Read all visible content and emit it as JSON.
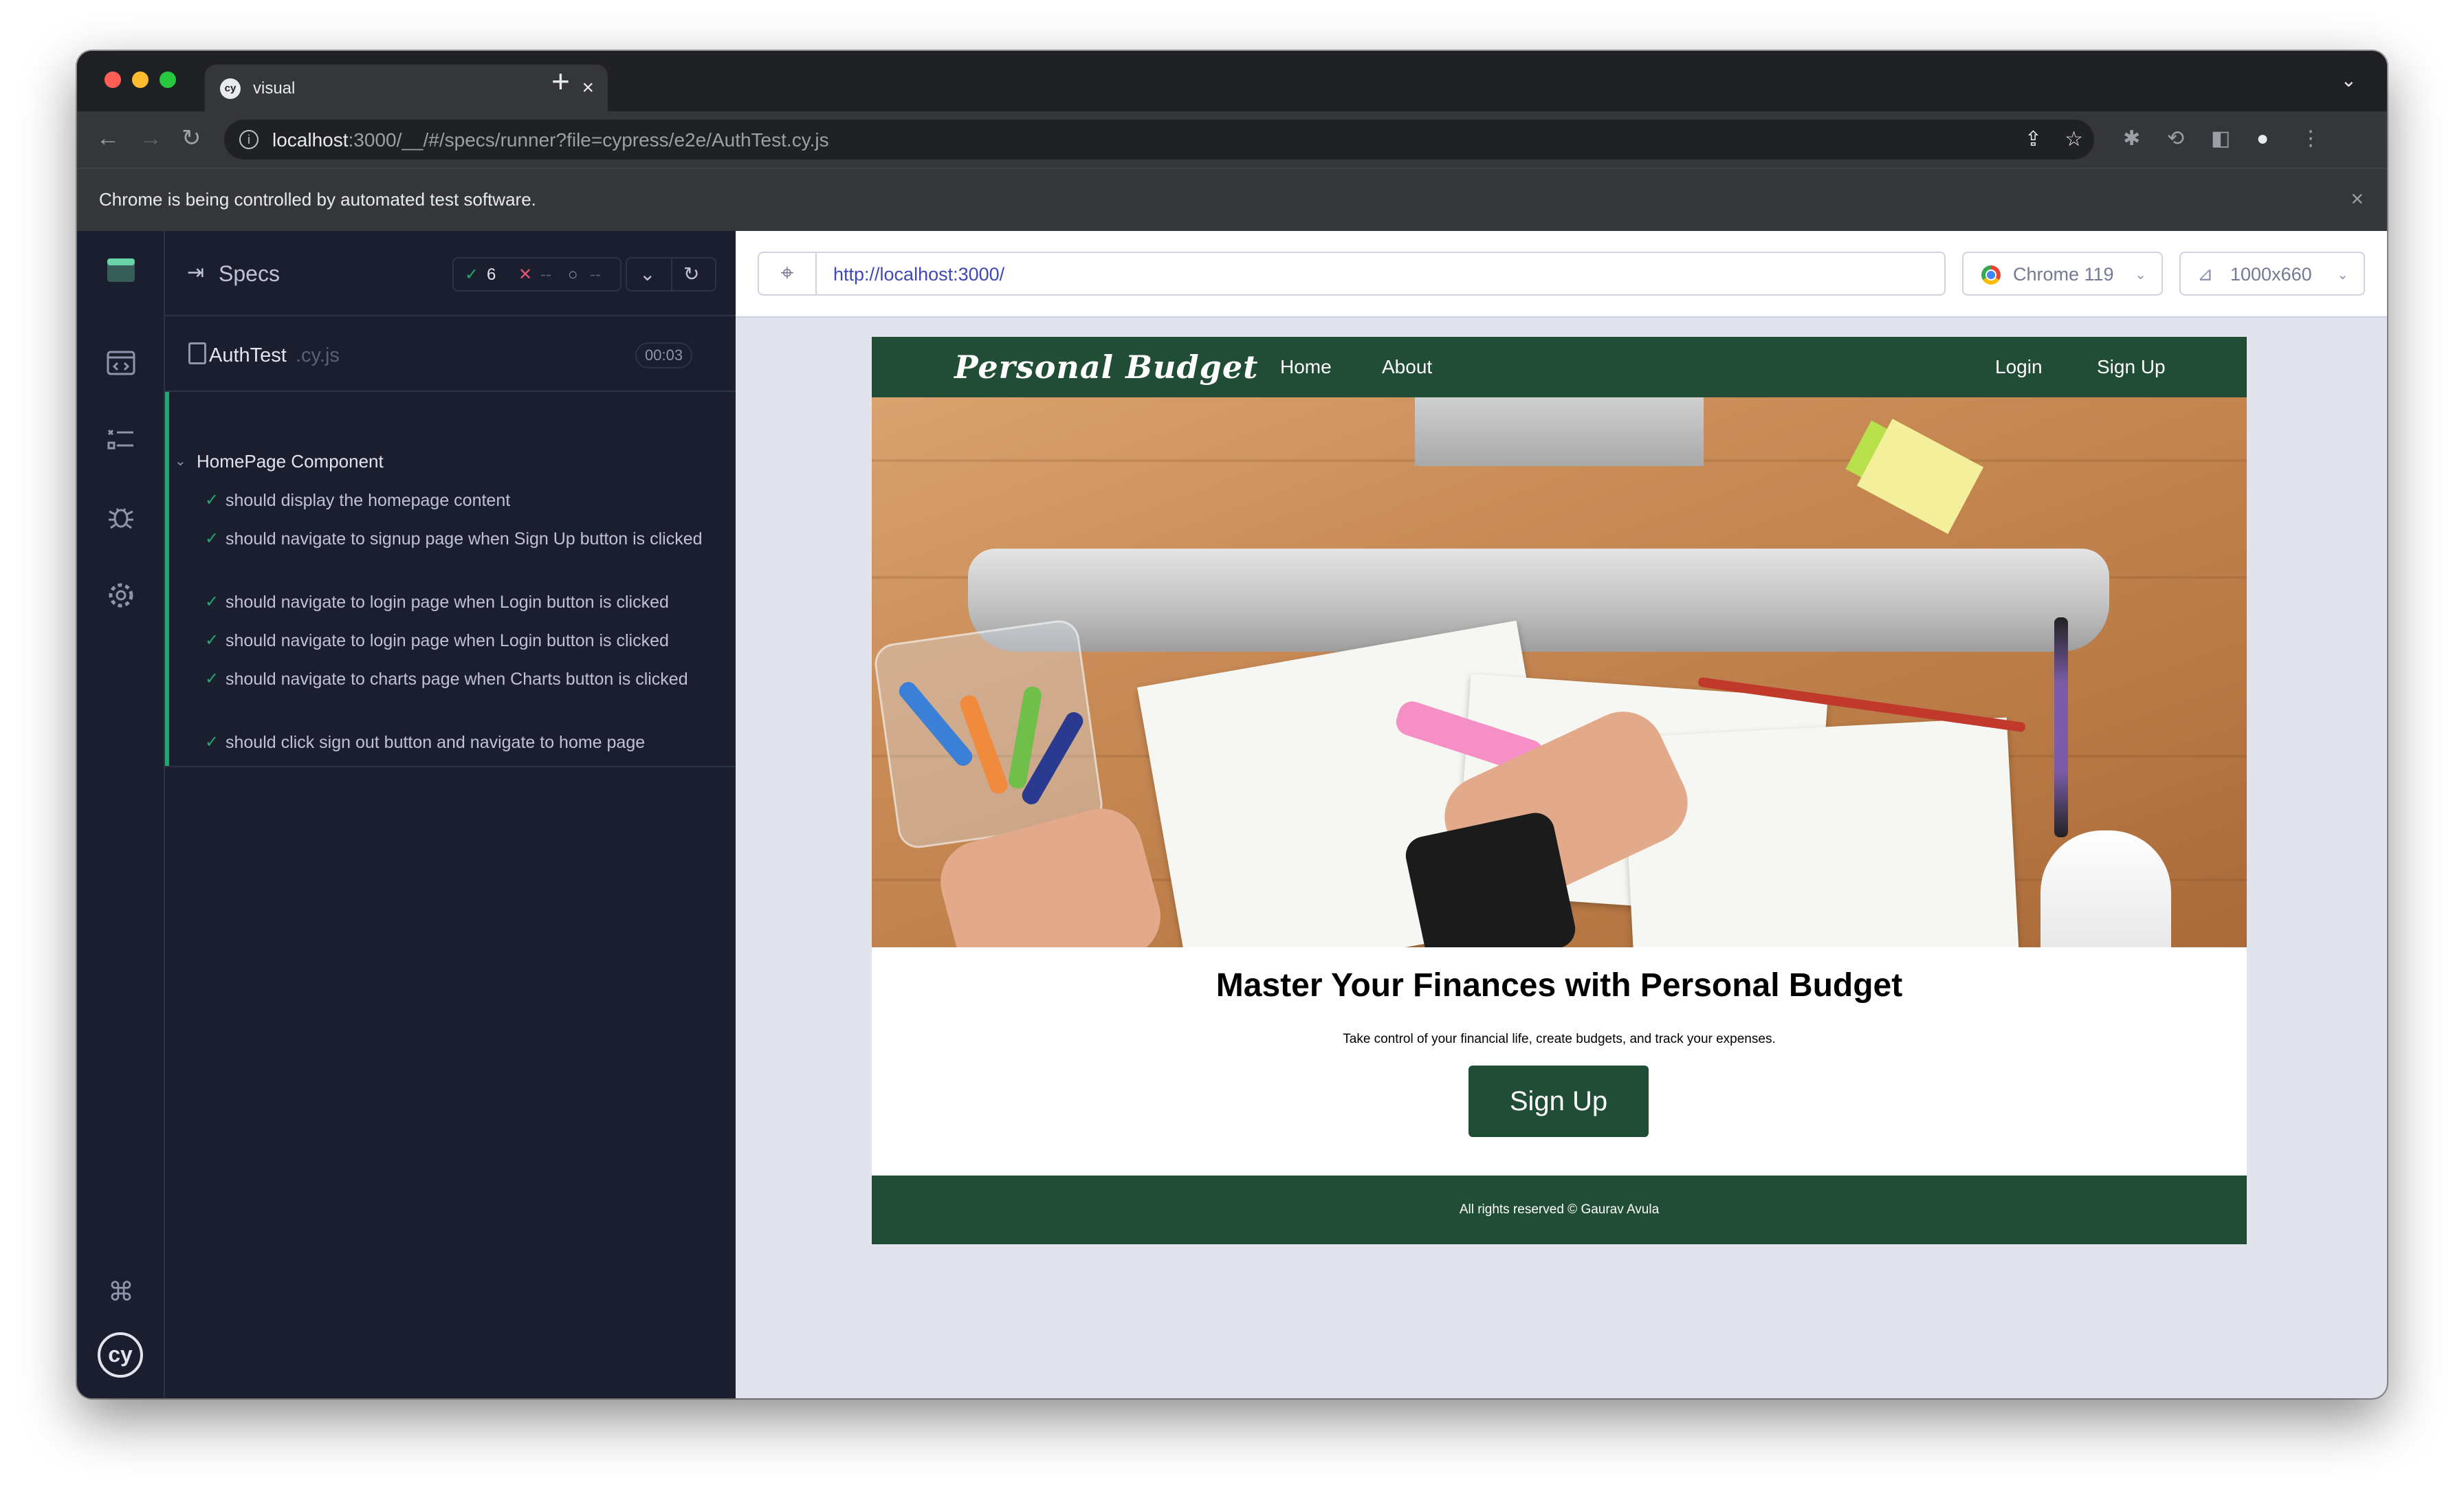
{
  "browser": {
    "tab_title": "visual",
    "tab_favicon": "cy",
    "new_tab_icon": "+",
    "close_tab_icon": "×",
    "url_host": "localhost",
    "url_rest": ":3000/__/#/specs/runner?file=cypress/e2e/AuthTest.cy.js",
    "infobar_text": "Chrome is being controlled by automated test software."
  },
  "reporter": {
    "header_label": "Specs",
    "stats": {
      "passed": "6",
      "failed": "--",
      "pending": "--"
    },
    "file": {
      "name": "AuthTest",
      "ext": ".cy.js",
      "duration": "00:03"
    },
    "suite_title": "HomePage Component",
    "tests": [
      {
        "label": "should display the homepage content"
      },
      {
        "label": "should navigate to signup page when Sign Up button is clicked"
      },
      {
        "label": "should navigate to login page when Login button is clicked"
      },
      {
        "label": "should navigate to login page when Login button is clicked"
      },
      {
        "label": "should navigate to charts page when Charts button is clicked"
      },
      {
        "label": "should click sign out button and navigate to home page"
      }
    ]
  },
  "aut_header": {
    "url": "http://localhost:3000/",
    "browser_label": "Chrome 119",
    "viewport_label": "1000x660"
  },
  "app": {
    "brand": "Personal Budget",
    "nav_home": "Home",
    "nav_about": "About",
    "nav_login": "Login",
    "nav_signup": "Sign Up",
    "headline": "Master Your Finances with Personal Budget",
    "subline": "Take control of your financial life, create budgets, and track your expenses.",
    "cta_label": "Sign Up",
    "footer_text": "All rights reserved © Gaurav Avula"
  },
  "colors": {
    "app_green": "#214d36",
    "cypress_bg": "#1b1e2e",
    "pass_green": "#1fa971",
    "fail_red": "#e45770"
  },
  "icons": {
    "nav": [
      "specs-list-icon",
      "runs-icon",
      "debug-icon",
      "settings-icon",
      "keyboard-shortcuts-icon"
    ]
  }
}
